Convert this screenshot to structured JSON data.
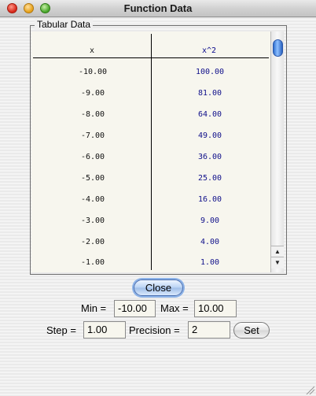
{
  "window": {
    "title": "Function Data"
  },
  "group": {
    "label": "Tabular Data"
  },
  "table": {
    "headers": {
      "x": "x",
      "y": "x^2"
    },
    "rows": [
      {
        "x": "-10.00",
        "y": "100.00"
      },
      {
        "x": "-9.00",
        "y": "81.00"
      },
      {
        "x": "-8.00",
        "y": "64.00"
      },
      {
        "x": "-7.00",
        "y": "49.00"
      },
      {
        "x": "-6.00",
        "y": "36.00"
      },
      {
        "x": "-5.00",
        "y": "25.00"
      },
      {
        "x": "-4.00",
        "y": "16.00"
      },
      {
        "x": "-3.00",
        "y": "9.00"
      },
      {
        "x": "-2.00",
        "y": "4.00"
      },
      {
        "x": "-1.00",
        "y": "1.00"
      }
    ]
  },
  "controls": {
    "close_label": "Close",
    "min_label": "Min =",
    "min_value": "-10.00",
    "max_label": "Max =",
    "max_value": "10.00",
    "step_label": "Step =",
    "step_value": "1.00",
    "precision_label": "Precision =",
    "precision_value": "2",
    "set_label": "Set"
  }
}
